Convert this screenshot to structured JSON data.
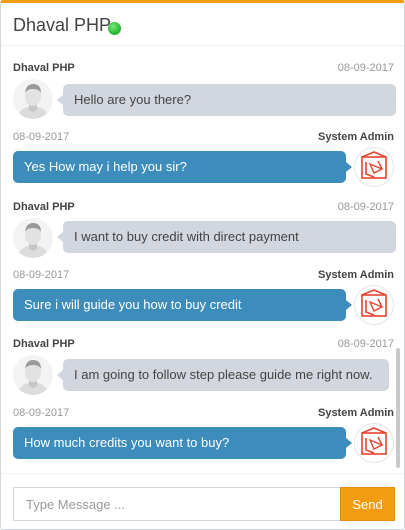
{
  "header": {
    "title": "Dhaval PHP",
    "status_color": "#2fbf3a"
  },
  "messages": [
    {
      "side": "left",
      "name": "Dhaval PHP",
      "time": "08-09-2017",
      "text": "Hello are you there?"
    },
    {
      "side": "right",
      "name": "System Admin",
      "time": "08-09-2017",
      "text": "Yes How may i help you sir?"
    },
    {
      "side": "left",
      "name": "Dhaval PHP",
      "time": "08-09-2017",
      "text": "I want to buy credit with direct payment"
    },
    {
      "side": "right",
      "name": "System Admin",
      "time": "08-09-2017",
      "text": "Sure i will guide you how to buy credit"
    },
    {
      "side": "left",
      "name": "Dhaval PHP",
      "time": "08-09-2017",
      "text": "I am going to follow step please guide me right now."
    },
    {
      "side": "right",
      "name": "System Admin",
      "time": "08-09-2017",
      "text": "How much credits you want to buy?"
    }
  ],
  "footer": {
    "input_placeholder": "Type Message ...",
    "send_label": "Send"
  },
  "colors": {
    "accent": "#f39c12",
    "user_bubble": "#d2d6de",
    "admin_bubble": "#3c8dbc"
  },
  "icons": {
    "user_avatar": "user-silhouette-icon",
    "admin_avatar": "laravel-logo-icon"
  }
}
